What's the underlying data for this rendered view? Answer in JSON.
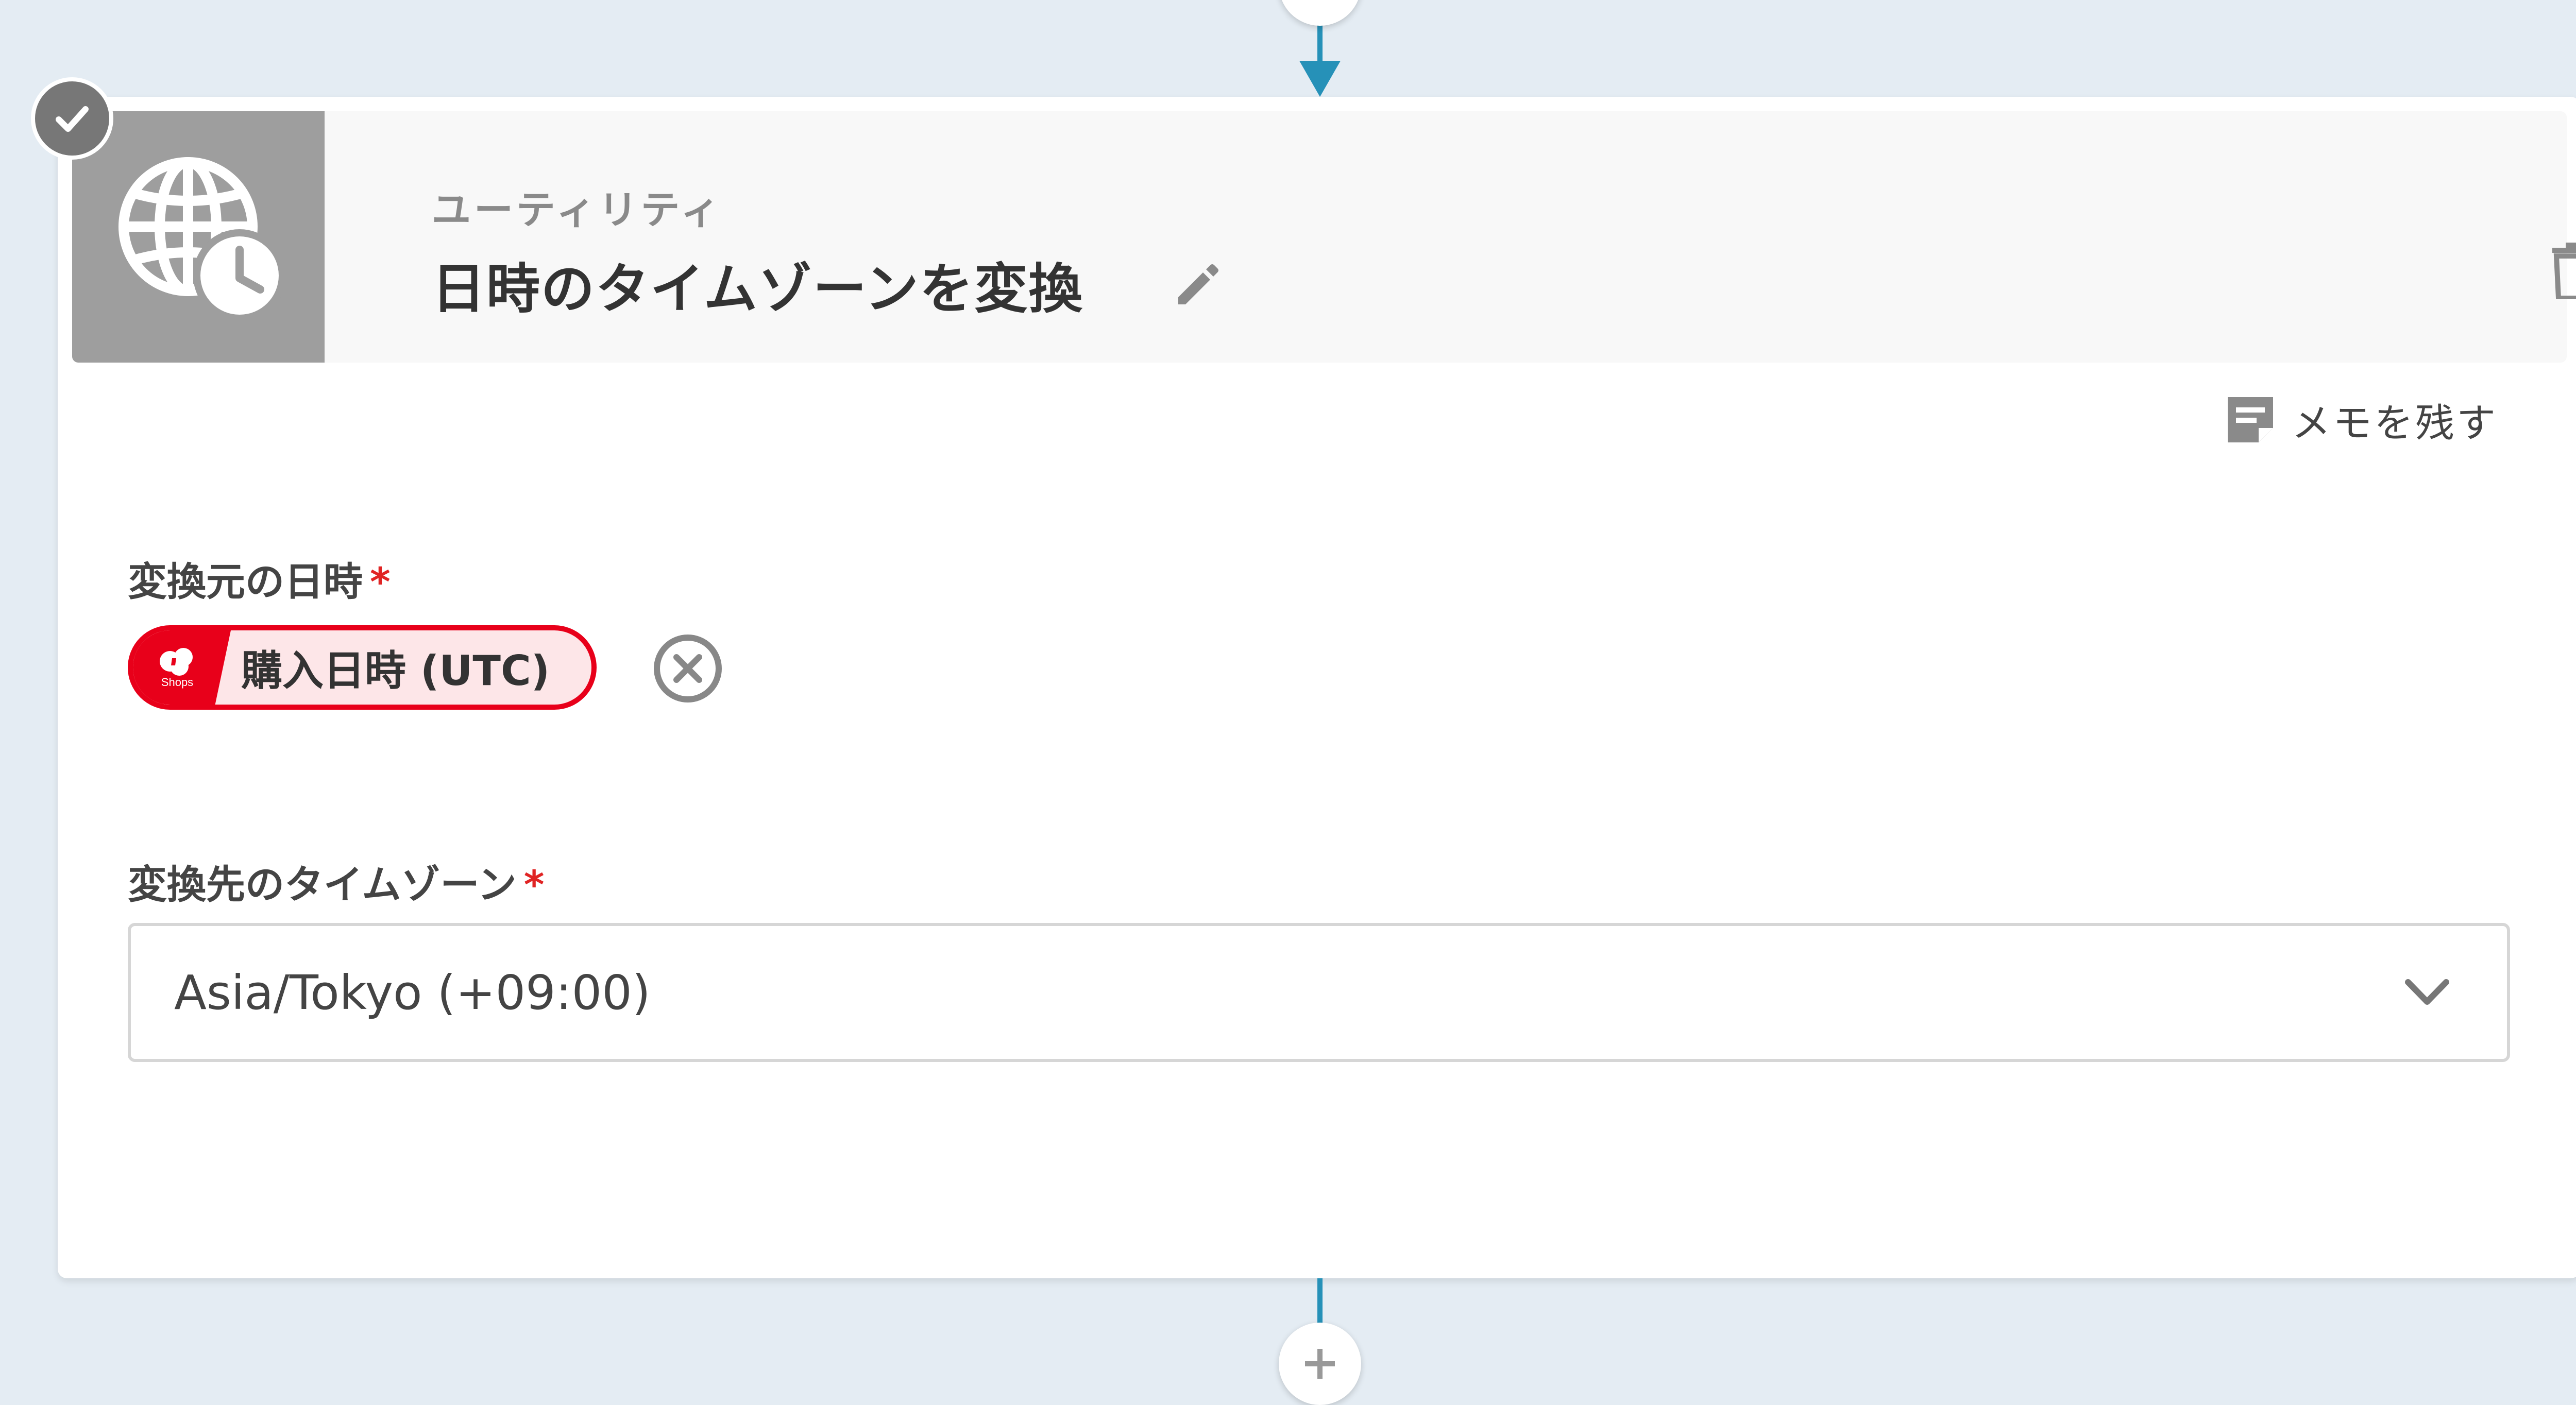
{
  "step": {
    "category": "ユーティリティ",
    "title": "日時のタイムゾーンを変換"
  },
  "memo": {
    "label": "メモを残す"
  },
  "fields": {
    "source": {
      "label": "変換元の日時",
      "required": "*",
      "token": {
        "text": "購入日時 (UTC)",
        "logo_text": "Shops",
        "color": "#e8001a"
      }
    },
    "target": {
      "label": "変換先のタイムゾーン",
      "required": "*",
      "value": "Asia/Tokyo (+09:00)"
    }
  },
  "colors": {
    "background": "#e4ecf3",
    "connector": "#2691b8",
    "header_icon_bg": "#9e9e9e",
    "required": "#e02424"
  },
  "icons": {
    "app": "globe-clock-icon",
    "status": "checkmark-icon",
    "edit": "pencil-icon",
    "delete": "trash-icon",
    "memo": "note-icon",
    "remove": "close-circle-icon",
    "dropdown": "chevron-down-icon",
    "add": "plus-icon"
  }
}
